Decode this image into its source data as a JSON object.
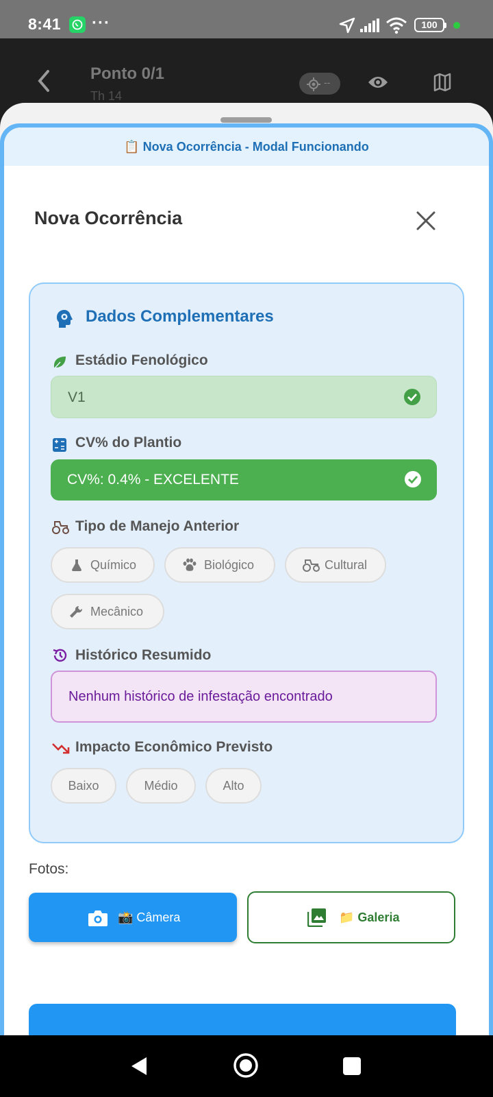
{
  "status_bar": {
    "time": "8:41",
    "overflow": "···",
    "battery": "100"
  },
  "app_bar": {
    "title": "Ponto 0/1",
    "subtitle": "Th 14",
    "gps_text": "--"
  },
  "banner": "📋 Nova Ocorrência - Modal Funcionando",
  "modal": {
    "title": "Nova Ocorrência"
  },
  "card": {
    "title": "Dados Complementares",
    "phenology": {
      "label": "Estádio Fenológico",
      "value": "V1"
    },
    "cv": {
      "label": "CV% do Plantio",
      "value": "CV%: 0.4% - EXCELENTE"
    },
    "management": {
      "label": "Tipo de Manejo Anterior",
      "options": [
        "Químico",
        "Biológico",
        "Cultural",
        "Mecânico"
      ]
    },
    "history": {
      "label": "Histórico Resumido",
      "value": "Nenhum histórico de infestação encontrado"
    },
    "impact": {
      "label": "Impacto Econômico Previsto",
      "options": [
        "Baixo",
        "Médio",
        "Alto"
      ]
    }
  },
  "photos": {
    "label": "Fotos:",
    "camera": "📸 Câmera",
    "gallery": "📁 Galeria"
  },
  "colors": {
    "accent": "#2196f3",
    "success": "#4caf50",
    "history": "#6a1b9a",
    "primary_text": "#1e6fb5"
  }
}
